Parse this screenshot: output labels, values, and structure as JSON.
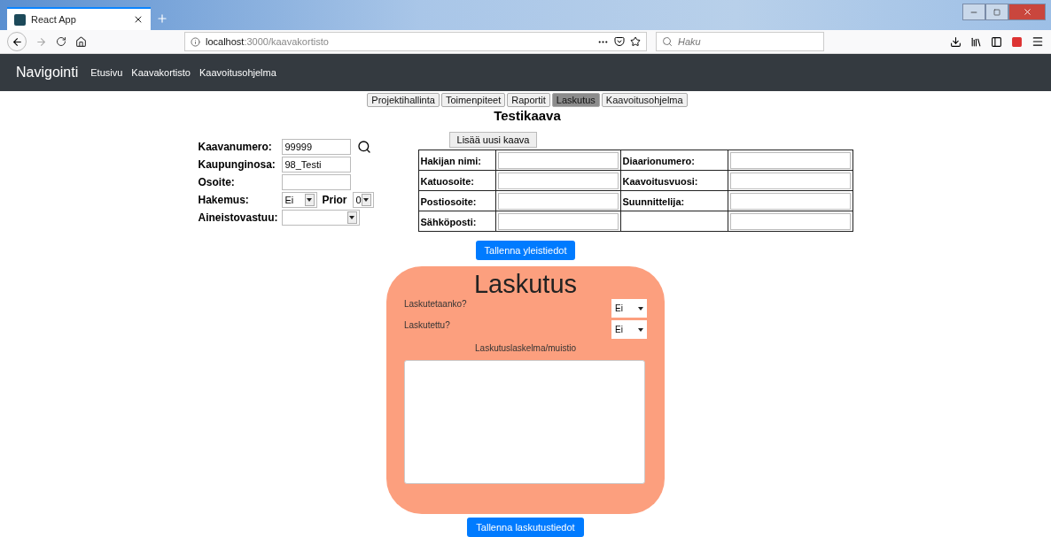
{
  "browser": {
    "tab_title": "React App",
    "url_host": "localhost",
    "url_path": ":3000/kaavakortisto",
    "search_placeholder": "Haku"
  },
  "navbar": {
    "brand": "Navigointi",
    "links": [
      "Etusivu",
      "Kaavakortisto",
      "Kaavoitusohjelma"
    ]
  },
  "tabs": [
    {
      "label": "Projektihallinta",
      "selected": false
    },
    {
      "label": "Toimenpiteet",
      "selected": false
    },
    {
      "label": "Raportit",
      "selected": false
    },
    {
      "label": "Laskutus",
      "selected": true
    },
    {
      "label": "Kaavoitusohjelma",
      "selected": false
    }
  ],
  "title": "Testikaava",
  "form": {
    "kaavanumero": {
      "label": "Kaavanumero:",
      "value": "99999"
    },
    "kaupunginosa": {
      "label": "Kaupunginosa:",
      "value": "98_Testi"
    },
    "osoite": {
      "label": "Osoite:"
    },
    "hakemus": {
      "label": "Hakemus:",
      "value": "Ei"
    },
    "prior": {
      "label": "Prior",
      "value": "0"
    },
    "aineistovastuu": {
      "label": "Aineistovastuu:"
    }
  },
  "add_button": "Lisää uusi kaava",
  "info_table": [
    {
      "label": "Hakijan nimi:",
      "label_2": "Diaarionumero:"
    },
    {
      "label": "Katuosoite:",
      "label_2": "Kaavoitusvuosi:"
    },
    {
      "label": "Postiosoite:",
      "label_2": "Suunnittelija:"
    },
    {
      "label": "Sähköposti:"
    }
  ],
  "save_general": "Tallenna yleistiedot",
  "billing": {
    "title": "Laskutus",
    "fields": [
      {
        "label": "Laskutetaanko?",
        "value": "Ei"
      },
      {
        "label": "Laskutettu?",
        "value": "Ei"
      }
    ],
    "memo_label": "Laskutuslaskelma/muistio",
    "save": "Tallenna laskutustiedot"
  }
}
